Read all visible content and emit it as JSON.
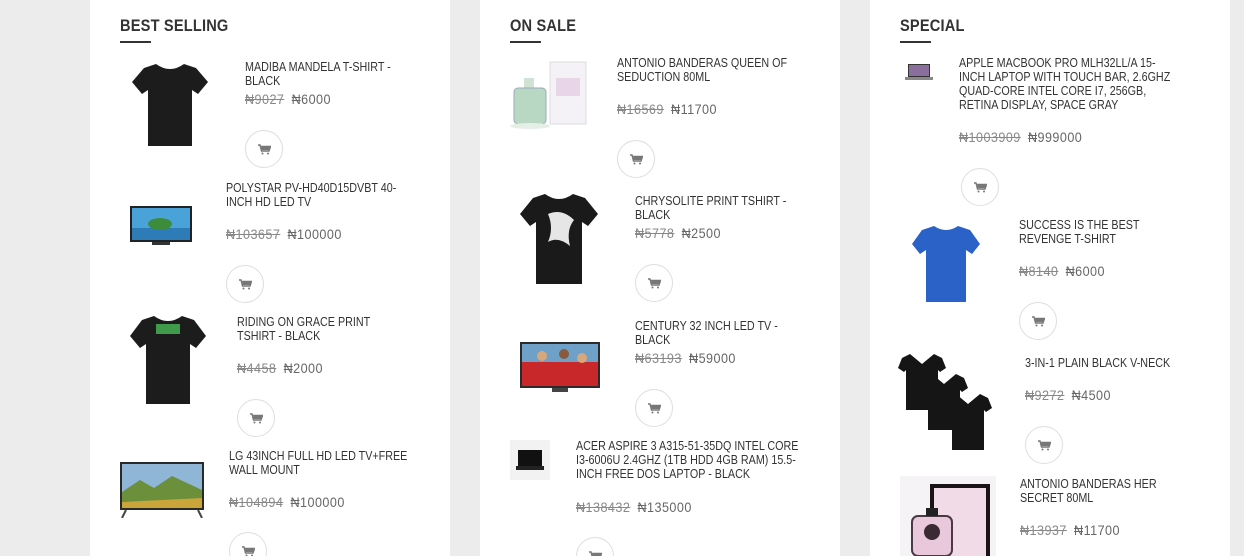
{
  "columns": [
    {
      "title": "BEST SELLING",
      "products": [
        {
          "name": "MADIBA MANDELA T-SHIRT - BLACK",
          "old_price": "₦9027",
          "price": "₦6000",
          "image": "black-tshirt"
        },
        {
          "name": "POLYSTAR PV-HD40D15DVBT 40-INCH HD LED TV",
          "old_price": "₦103657",
          "price": "₦100000",
          "image": "led-tv-ocean"
        },
        {
          "name": "RIDING ON GRACE PRINT TSHIRT - BLACK",
          "old_price": "₦4458",
          "price": "₦2000",
          "image": "black-tshirt-green-print"
        },
        {
          "name": "LG 43INCH FULL HD LED TV+FREE WALL MOUNT",
          "old_price": "₦104894",
          "price": "₦100000",
          "image": "led-tv-landscape"
        }
      ]
    },
    {
      "title": "ON SALE",
      "products": [
        {
          "name": "ANTONIO BANDERAS QUEEN OF SEDUCTION 80ML",
          "old_price": "₦16569",
          "price": "₦11700",
          "image": "perfume-queen"
        },
        {
          "name": "CHRYSOLITE PRINT TSHIRT - BLACK",
          "old_price": "₦5778",
          "price": "₦2500",
          "image": "black-tshirt-white-print"
        },
        {
          "name": "CENTURY 32 INCH LED TV - BLACK",
          "old_price": "₦63193",
          "price": "₦59000",
          "image": "led-tv-football"
        },
        {
          "name": "ACER ASPIRE 3 A315-51-35DQ INTEL CORE I3-6006U 2.4GHZ (1TB HDD 4GB RAM) 15.5-INCH FREE DOS LAPTOP - BLACK",
          "old_price": "₦138432",
          "price": "₦135000",
          "image": "laptop-black"
        }
      ]
    },
    {
      "title": "SPECIAL",
      "products": [
        {
          "name": "APPLE MACBOOK PRO MLH32LL/A 15-INCH LAPTOP WITH TOUCH BAR, 2.6GHZ QUAD-CORE INTEL CORE I7, 256GB, RETINA DISPLAY, SPACE GRAY",
          "old_price": "₦1003909",
          "price": "₦999000",
          "image": "macbook"
        },
        {
          "name": "SUCCESS IS THE BEST REVENGE T-SHIRT",
          "old_price": "₦8140",
          "price": "₦6000",
          "image": "blue-tshirt"
        },
        {
          "name": "3-IN-1 PLAIN BLACK V-NECK",
          "old_price": "₦9272",
          "price": "₦4500",
          "image": "three-black-vnecks"
        },
        {
          "name": "ANTONIO BANDERAS HER SECRET 80ML",
          "old_price": "₦13937",
          "price": "₦11700",
          "image": "perfume-her-secret"
        }
      ]
    }
  ],
  "icons": {
    "cart": "cart-icon"
  },
  "colors": {
    "background": "#ececec",
    "panel": "#ffffff",
    "title": "#333333",
    "price": "#777777"
  }
}
